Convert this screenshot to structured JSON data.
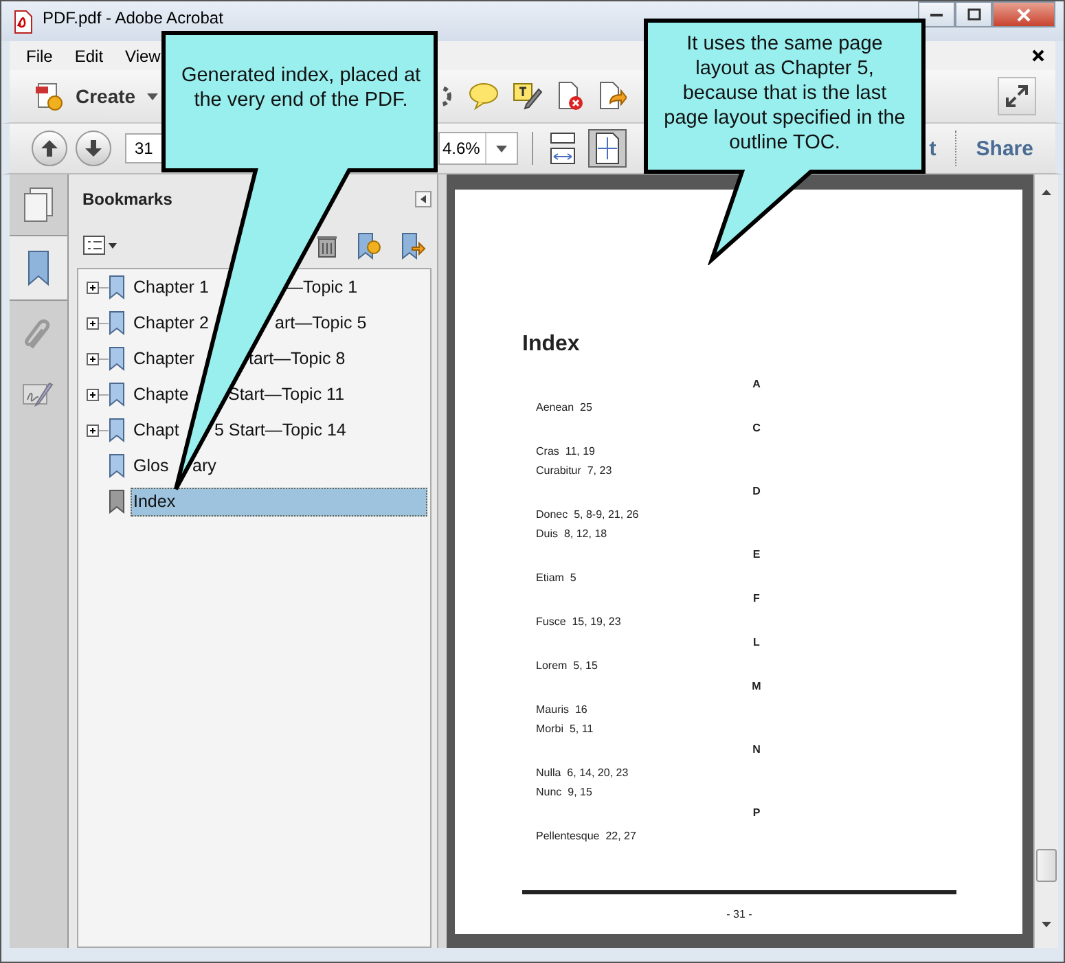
{
  "window": {
    "title": "PDF.pdf - Adobe Acrobat"
  },
  "menu": [
    "File",
    "Edit",
    "View"
  ],
  "toolbar": {
    "create": "Create"
  },
  "nav": {
    "page": "31",
    "zoom": "4.6%",
    "right_buttons": [
      "t",
      "Share"
    ]
  },
  "bookmarks": {
    "title": "Bookmarks",
    "items": [
      {
        "parts": [
          "Chapter 1",
          "—Topic 1"
        ],
        "expandable": true,
        "selected": false
      },
      {
        "parts": [
          "Chapter 2",
          "art—Topic 5"
        ],
        "expandable": true,
        "selected": false
      },
      {
        "parts": [
          "Chapter",
          "tart—Topic 8"
        ],
        "expandable": true,
        "selected": false
      },
      {
        "parts": [
          "Chapte",
          "Start—Topic 11"
        ],
        "expandable": true,
        "selected": false
      },
      {
        "parts": [
          "Chapt",
          "5 Start—Topic 14"
        ],
        "expandable": true,
        "selected": false
      },
      {
        "parts": [
          "Glos",
          "ary"
        ],
        "expandable": false,
        "selected": false
      },
      {
        "parts": [
          "Index"
        ],
        "expandable": false,
        "selected": true
      }
    ]
  },
  "document": {
    "heading": "Index",
    "sections": [
      {
        "letter": "A",
        "entries": [
          "Aenean  25"
        ]
      },
      {
        "letter": "C",
        "entries": [
          "Cras  11, 19",
          "Curabitur  7, 23"
        ]
      },
      {
        "letter": "D",
        "entries": [
          "Donec  5, 8-9, 21, 26",
          "Duis  8, 12, 18"
        ]
      },
      {
        "letter": "E",
        "entries": [
          "Etiam  5"
        ]
      },
      {
        "letter": "F",
        "entries": [
          "Fusce  15, 19, 23"
        ]
      },
      {
        "letter": "L",
        "entries": [
          "Lorem  5, 15"
        ]
      },
      {
        "letter": "M",
        "entries": [
          "Mauris  16",
          "Morbi  5, 11"
        ]
      },
      {
        "letter": "N",
        "entries": [
          "Nulla  6, 14, 20, 23",
          "Nunc  9, 15"
        ]
      },
      {
        "letter": "P",
        "entries": [
          "Pellentesque  22, 27"
        ]
      }
    ],
    "page_number": "- 31 -"
  },
  "callouts": [
    {
      "text": "Generated index, placed at the very end of the PDF."
    },
    {
      "text": "It uses the same page layout as Chapter 5, because that is the last page layout specified in the outline TOC."
    }
  ]
}
